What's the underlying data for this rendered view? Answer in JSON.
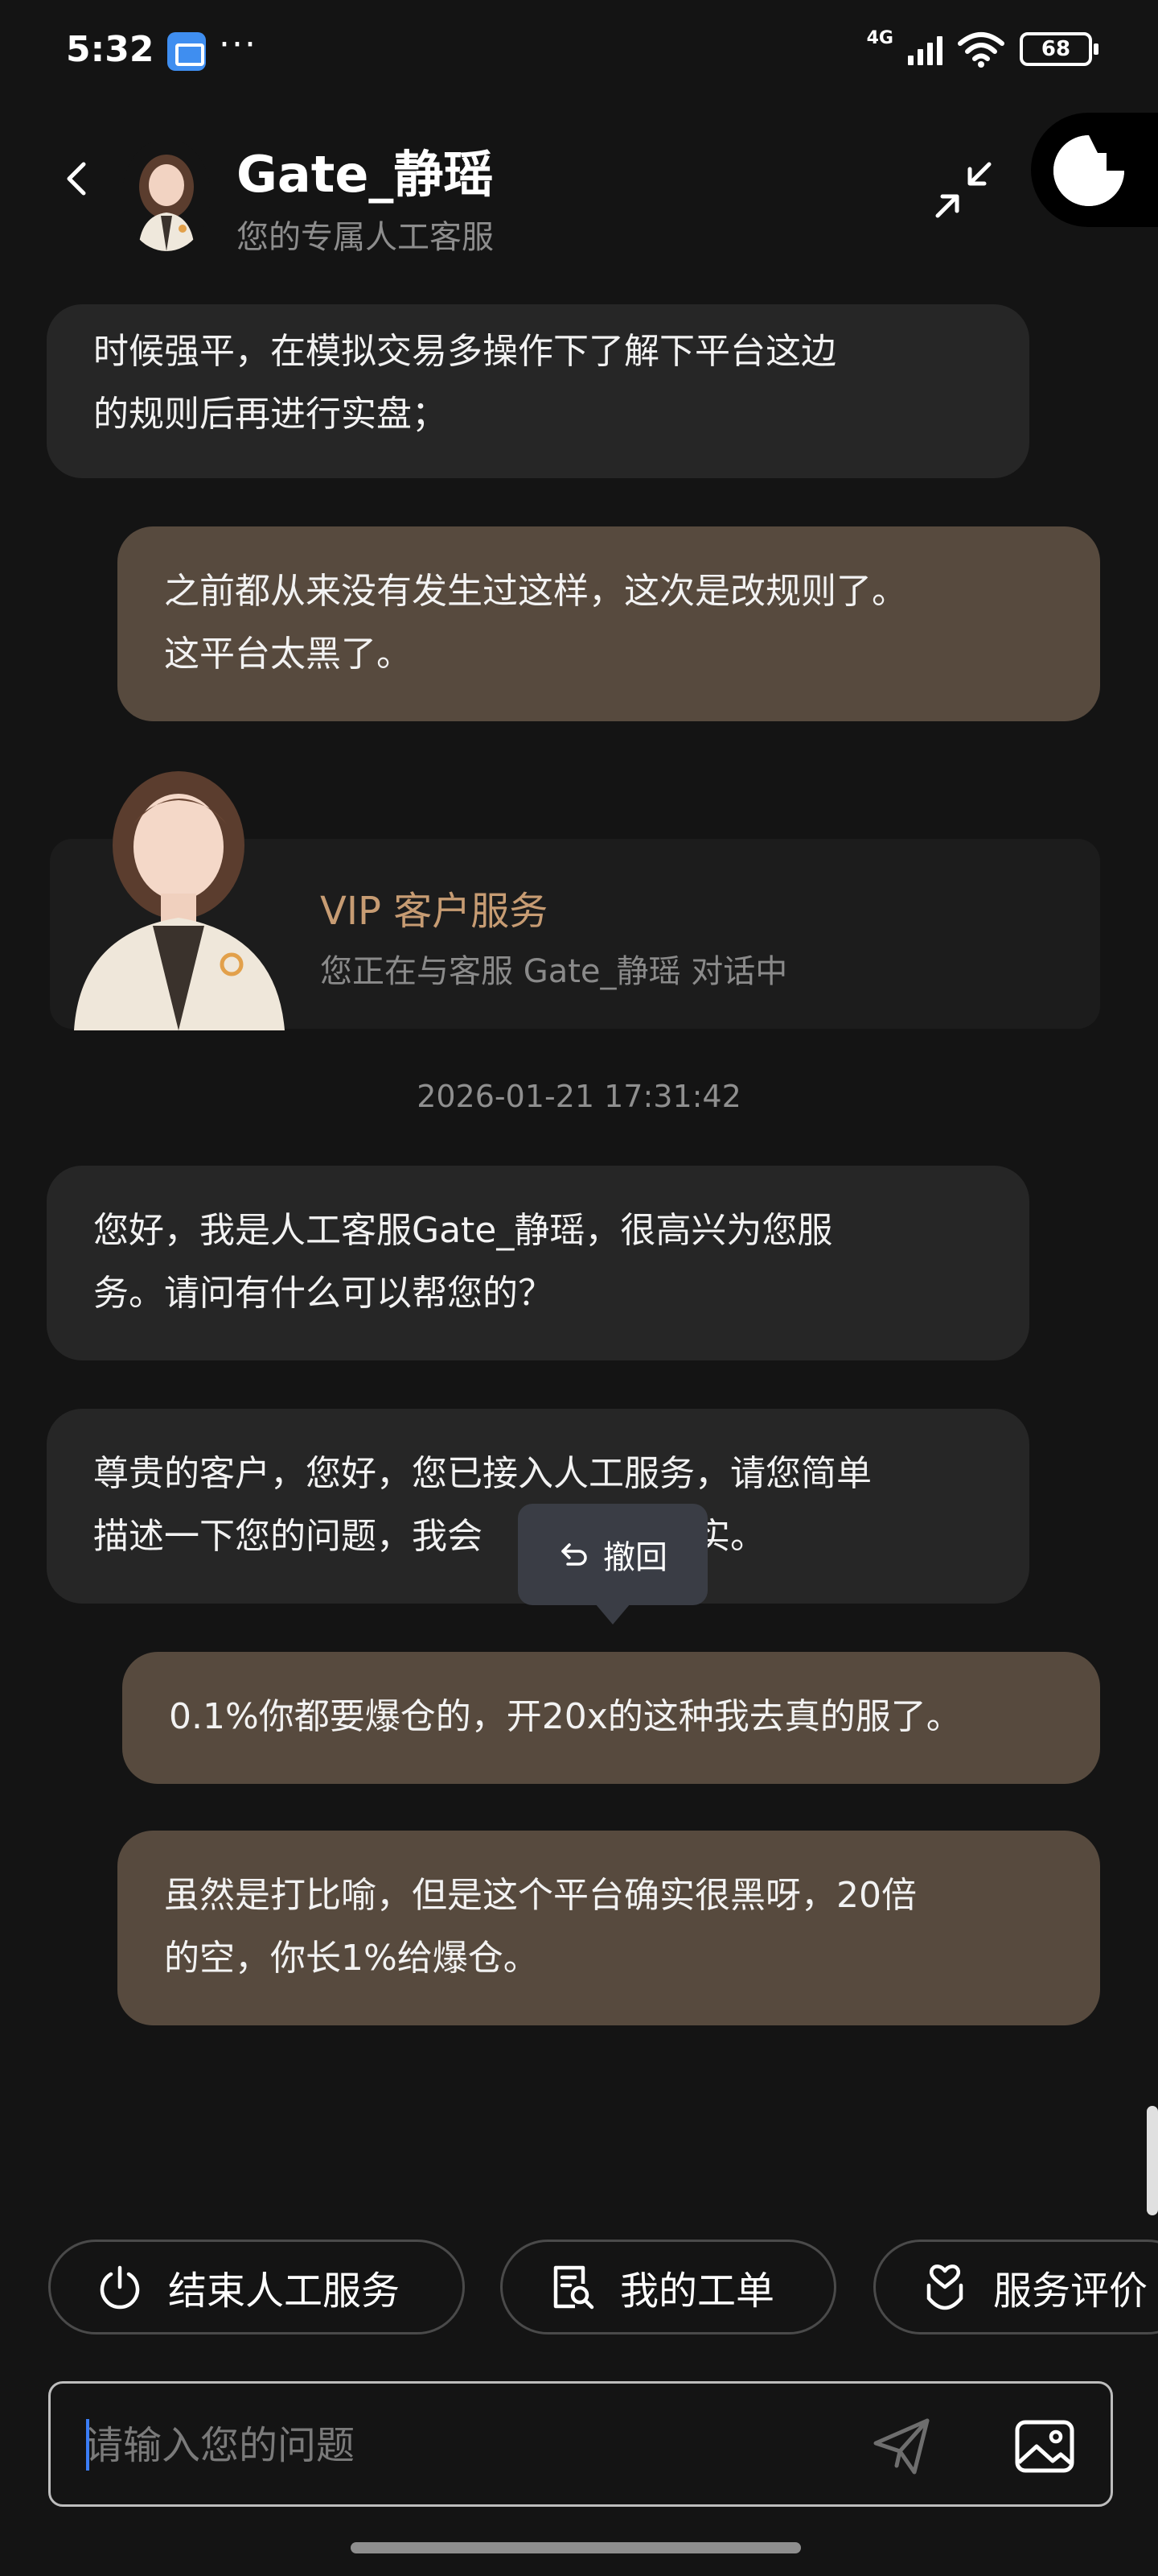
{
  "status_bar": {
    "time": "5:32",
    "dots": "···",
    "network": "4G",
    "wifi_label": "6",
    "battery": "68"
  },
  "header": {
    "agent_name": "Gate_静瑶",
    "agent_subtitle": "您的专属人工客服",
    "icons": [
      "back-icon",
      "avatar",
      "shrink-icon",
      "gate-logo-icon"
    ]
  },
  "messages": [
    {
      "side": "in",
      "text": "时候强平，在模拟交易多操作下了解下平台这边\n的规则后再进行实盘；"
    },
    {
      "side": "out",
      "text": "之前都从来没有发生过这样，这次是改规则了。\n这平台太黑了。"
    },
    {
      "side": "in",
      "text": "您好，我是人工客服Gate_静瑶，很高兴为您服\n务。请问有什么可以帮您的？"
    },
    {
      "side": "in",
      "text": "尊贵的客户，您好，您已接入人工服务，请您简单\n描述一下您的问题，我会　　　　　核实。"
    },
    {
      "side": "out",
      "text": "0.1%你都要爆仓的，开20x的这种我去真的服了。"
    },
    {
      "side": "out",
      "text": "虽然是打比喻，但是这个平台确实很黑呀，20倍\n的空，你长1%给爆仓。"
    }
  ],
  "vip_card": {
    "title": "VIP 客户服务",
    "subtitle": "您正在与客服 Gate_静瑶 对话中"
  },
  "timestamp": "2026-01-21 17:31:42",
  "recall_popup": {
    "label": "撤回"
  },
  "actions": [
    {
      "label": "结束人工服务",
      "icon": "power-icon"
    },
    {
      "label": "我的工单",
      "icon": "ticket-search-icon"
    },
    {
      "label": "服务评价",
      "icon": "heart-hand-icon"
    }
  ],
  "input": {
    "placeholder": "请输入您的问题",
    "value": ""
  },
  "colors": {
    "background": "#141414",
    "incoming_bubble": "#262626",
    "outgoing_bubble": "#574a3e",
    "vip_accent": "#c79c73"
  }
}
